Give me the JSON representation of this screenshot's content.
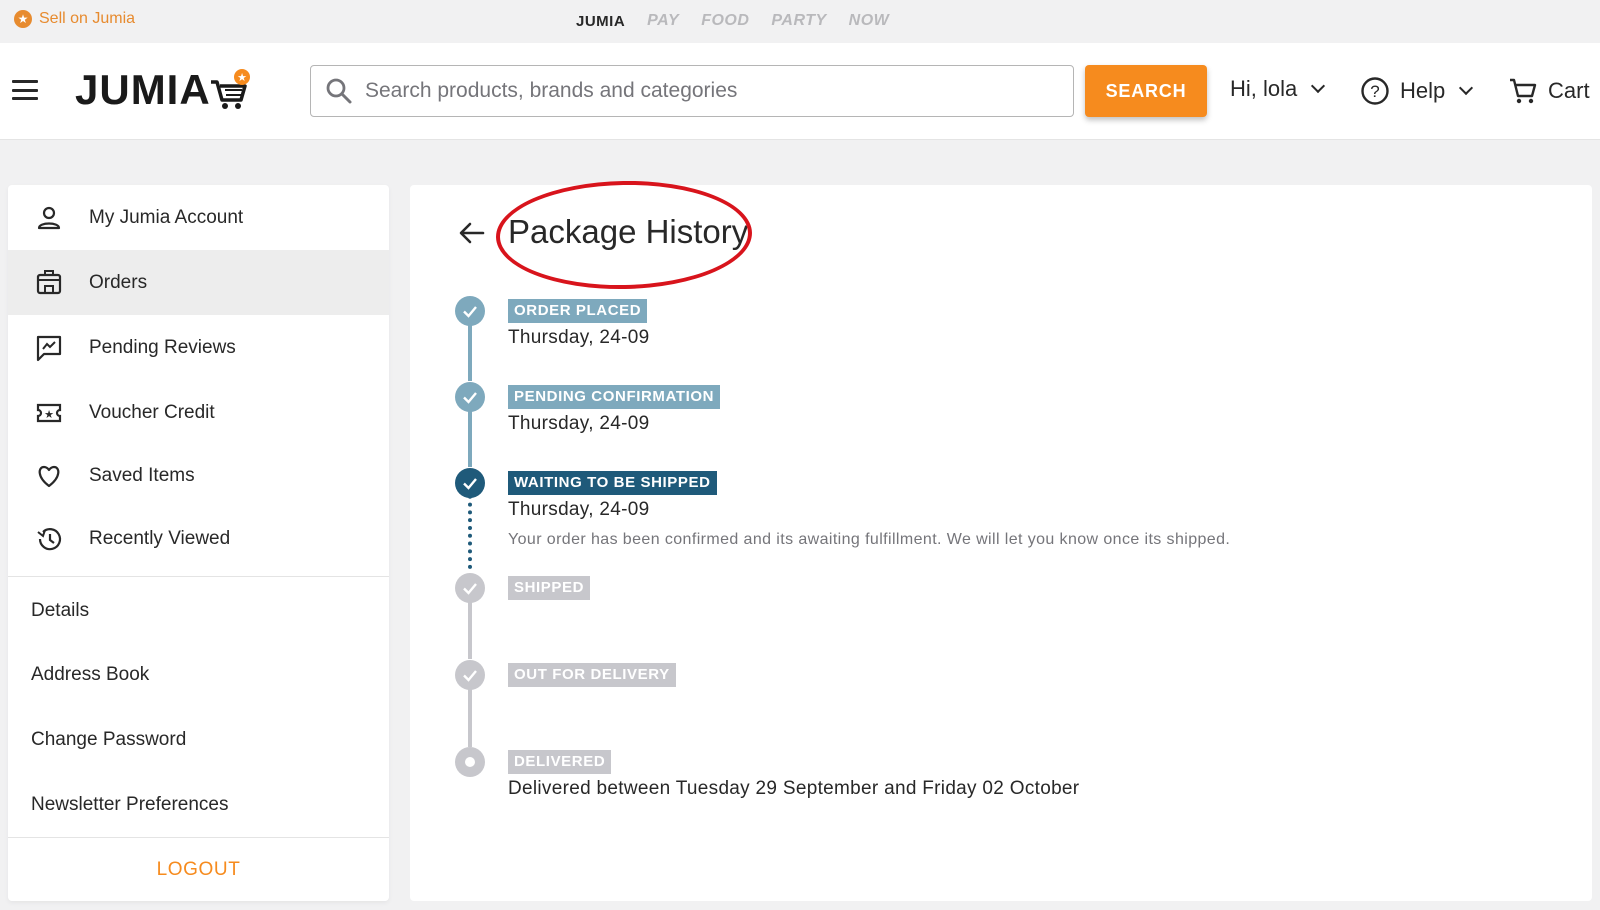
{
  "topbar": {
    "sell_label": "Sell on Jumia",
    "brands": [
      "JUMIA",
      "PAY",
      "FOOD",
      "PARTY",
      "NOW"
    ]
  },
  "header": {
    "logo_text": "JUMIA",
    "search_placeholder": "Search products, brands and categories",
    "search_button": "SEARCH",
    "account_label": "Hi, lola",
    "help_label": "Help",
    "cart_label": "Cart"
  },
  "sidebar": {
    "items": [
      {
        "label": "My Jumia Account",
        "icon": "user-icon"
      },
      {
        "label": "Orders",
        "icon": "orders-icon"
      },
      {
        "label": "Pending Reviews",
        "icon": "review-icon"
      },
      {
        "label": "Voucher Credit",
        "icon": "voucher-icon"
      },
      {
        "label": "Saved Items",
        "icon": "heart-icon"
      },
      {
        "label": "Recently Viewed",
        "icon": "history-icon"
      }
    ],
    "links": [
      "Details",
      "Address Book",
      "Change Password",
      "Newsletter Preferences"
    ],
    "logout": "LOGOUT"
  },
  "main": {
    "title": "Package History",
    "steps": [
      {
        "status": "ORDER PLACED",
        "date": "Thursday, 24-09",
        "state": "done"
      },
      {
        "status": "PENDING CONFIRMATION",
        "date": "Thursday, 24-09",
        "state": "done"
      },
      {
        "status": "WAITING TO BE SHIPPED",
        "date": "Thursday, 24-09",
        "state": "current",
        "note": "Your order has been confirmed and its awaiting fulfillment. We will let you know once its shipped."
      },
      {
        "status": "SHIPPED",
        "state": "future"
      },
      {
        "status": "OUT FOR DELIVERY",
        "state": "future"
      },
      {
        "status": "DELIVERED",
        "date": "Delivered between Tuesday 29 September and Friday 02 October",
        "state": "future"
      }
    ]
  },
  "colors": {
    "accent": "#f68b1e",
    "step_done": "#7ea9bd",
    "step_current": "#1f5a7a",
    "step_future": "#c7c7cc",
    "annotation": "#d8141c"
  }
}
